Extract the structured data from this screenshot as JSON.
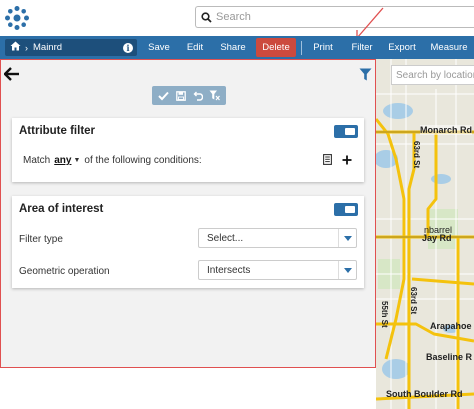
{
  "search": {
    "placeholder": "Search"
  },
  "toolbar": {
    "breadcrumb_title": "Mainrd",
    "info_label": "i",
    "save_label": "Save",
    "edit_label": "Edit",
    "share_label": "Share",
    "delete_label": "Delete",
    "print_label": "Print",
    "filter_label": "Filter",
    "export_label": "Export",
    "measure_label": "Measure",
    "delete_color": "#cc4a3e",
    "bar_color": "#2c6fa8"
  },
  "map": {
    "search_placeholder": "Search by location",
    "labels": [
      "Monarch Rd",
      "63rd St",
      "nbarrel",
      "Jay Rd",
      "63rd St",
      "55th St",
      "Arapahoe",
      "Baseline R",
      "South Boulder Rd"
    ]
  },
  "panel": {
    "attribute_filter": {
      "title": "Attribute filter",
      "match_prefix": "Match",
      "match_any": "any",
      "match_suffix": "of the following conditions:"
    },
    "area_of_interest": {
      "title": "Area of interest",
      "filter_type_label": "Filter type",
      "filter_type_value": "Select...",
      "geometric_operation_label": "Geometric operation",
      "geometric_operation_value": "Intersects"
    }
  },
  "annotation_color": "#e05050"
}
